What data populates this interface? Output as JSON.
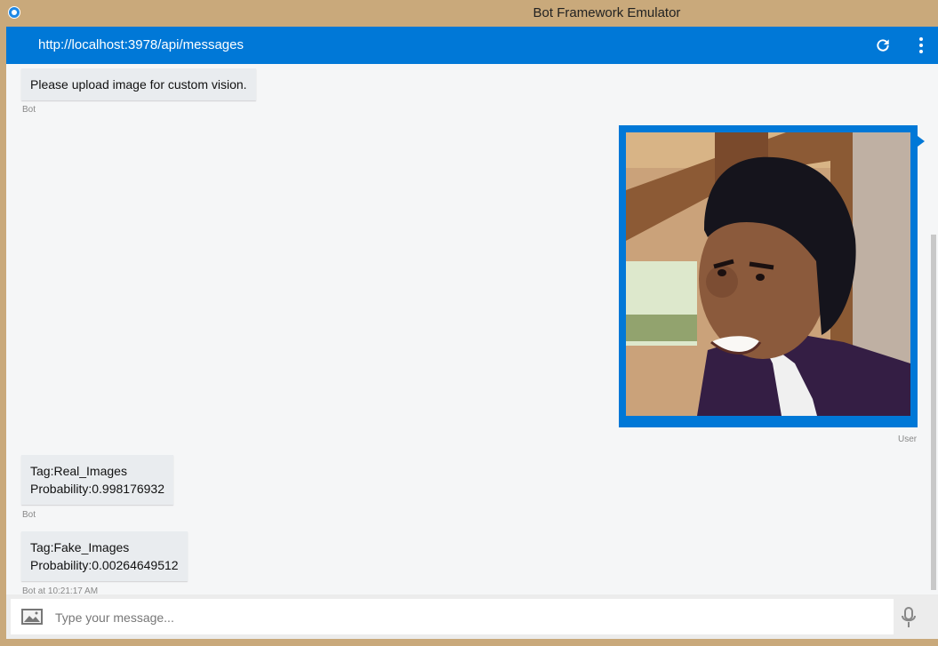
{
  "window": {
    "title": "Bot Framework Emulator"
  },
  "address": {
    "url": "http://localhost:3978/api/messages"
  },
  "messages": [
    {
      "lines": [
        "Please upload image for custom vision."
      ],
      "meta": "Bot"
    },
    {
      "meta": "User"
    },
    {
      "lines": [
        "Tag:Real_Images",
        "Probability:0.998176932"
      ],
      "meta": "Bot"
    },
    {
      "lines": [
        "Tag:Fake_Images",
        "Probability:0.00264649512"
      ],
      "meta": "Bot at 10:21:17 AM"
    }
  ],
  "composer": {
    "placeholder": "Type your message..."
  },
  "icons": {
    "app": "bot-emulator-icon",
    "refresh": "refresh-icon",
    "menu": "more-vertical-icon",
    "upload": "image-upload-icon",
    "mic": "microphone-icon"
  },
  "colors": {
    "accent": "#0078d7",
    "chrome": "#c9a97b",
    "bot_bubble": "#e9ecef"
  }
}
